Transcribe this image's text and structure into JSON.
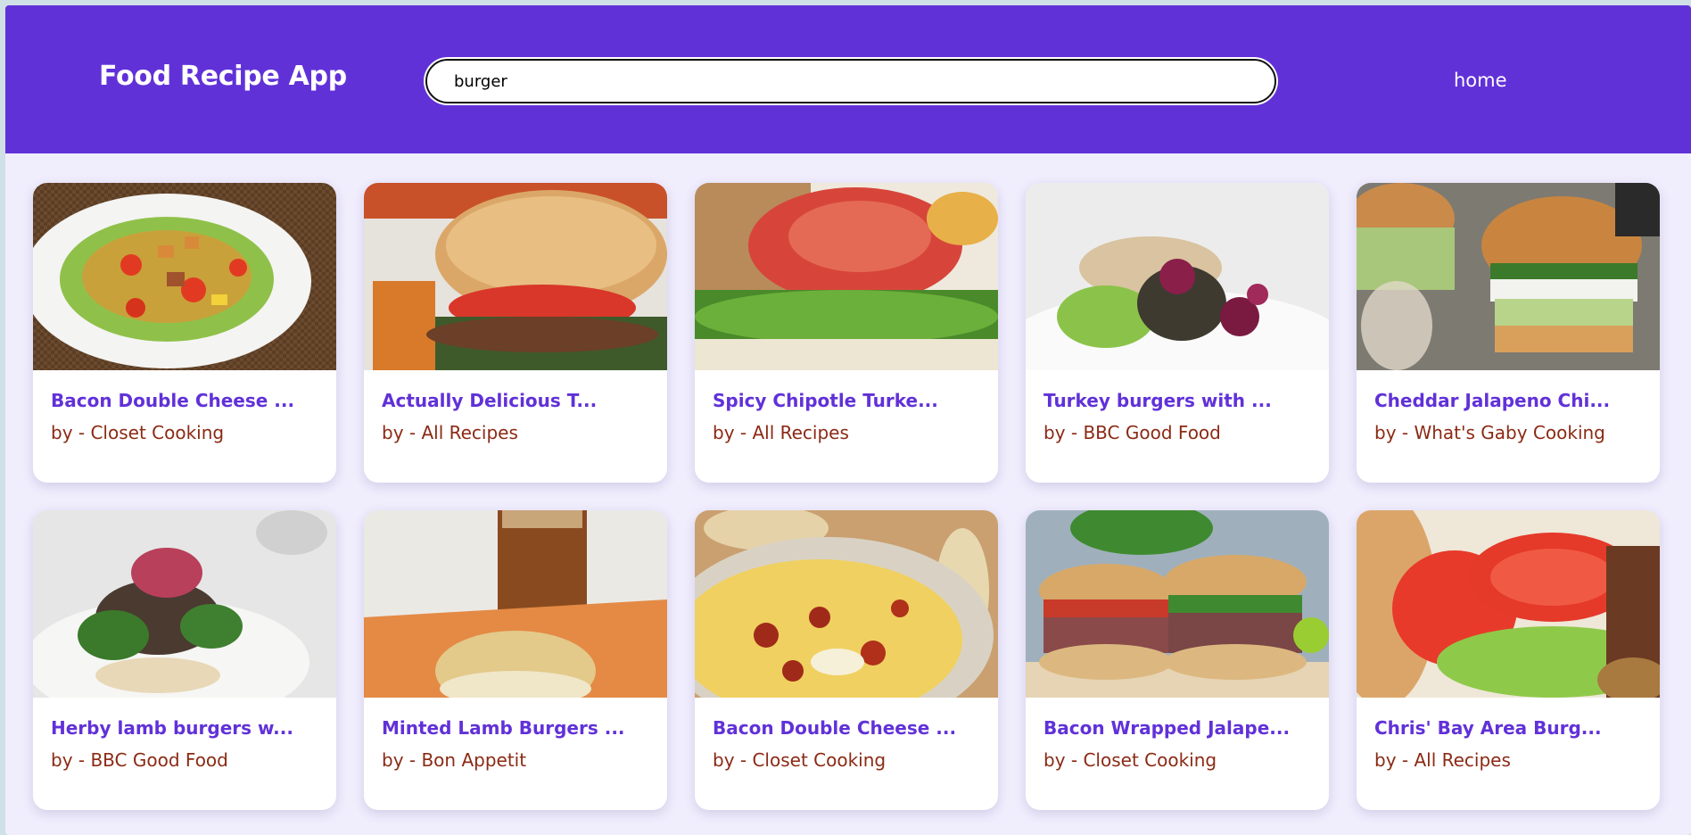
{
  "header": {
    "title": "Food Recipe App",
    "search_value": "burger",
    "nav_home": "home"
  },
  "recipes": [
    {
      "title": "Bacon Double Cheese ...",
      "source": "by - Closet Cooking",
      "image": "salad-plate"
    },
    {
      "title": "Actually Delicious T...",
      "source": "by - All Recipes",
      "image": "burger-tomato"
    },
    {
      "title": "Spicy Chipotle Turke...",
      "source": "by - All Recipes",
      "image": "burger-closeup"
    },
    {
      "title": "Turkey burgers with ...",
      "source": "by - BBC Good Food",
      "image": "patty-plate"
    },
    {
      "title": "Cheddar Jalapeno Chi...",
      "source": "by - What's Gaby Cooking",
      "image": "burgers-pair"
    },
    {
      "title": "Herby lamb burgers w...",
      "source": "by - BBC Good Food",
      "image": "lamb-burger"
    },
    {
      "title": "Minted Lamb Burgers ...",
      "source": "by - Bon Appetit",
      "image": "burger-beer"
    },
    {
      "title": "Bacon Double Cheese ...",
      "source": "by - Closet Cooking",
      "image": "cheese-dip"
    },
    {
      "title": "Bacon Wrapped Jalape...",
      "source": "by - Closet Cooking",
      "image": "burger-halves"
    },
    {
      "title": "Chris' Bay Area Burg...",
      "source": "by - All Recipes",
      "image": "burger-lettuce"
    }
  ],
  "colors": {
    "header_bg": "#6131d8",
    "page_bg": "#f0edfd",
    "title": "#6131d8",
    "source": "#8b2a14"
  }
}
